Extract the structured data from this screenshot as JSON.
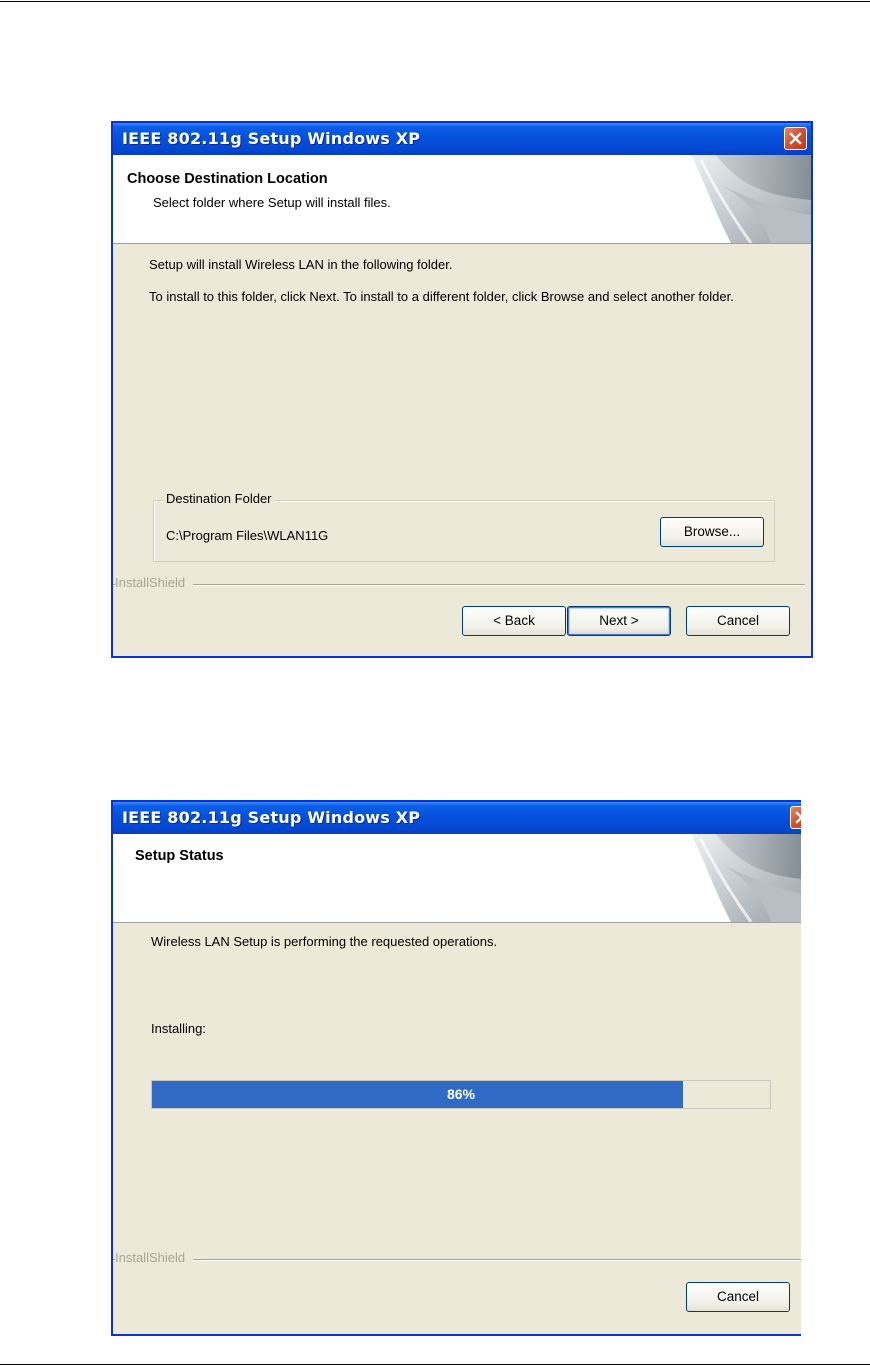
{
  "dialog1": {
    "title": "IEEE 802.11g Setup Windows XP",
    "header_title": "Choose Destination Location",
    "header_subtitle": "Select folder where Setup will install files.",
    "line1": "Setup will install Wireless LAN in the following folder.",
    "line2": "To install to this folder, click Next. To install to a different folder, click Browse and select another folder.",
    "group_label": "Destination Folder",
    "folder_path": "C:\\Program Files\\WLAN11G",
    "browse_label": "Browse...",
    "brand": "InstallShield",
    "back_label": "< Back",
    "next_label": "Next >",
    "cancel_label": "Cancel"
  },
  "dialog2": {
    "title": "IEEE 802.11g Setup Windows XP",
    "header_title": "Setup Status",
    "line1": "Wireless LAN Setup is performing the requested operations.",
    "status_label": "Installing:",
    "progress_percent": 86,
    "progress_text": "86%",
    "brand": "InstallShield",
    "cancel_label": "Cancel"
  },
  "colors": {
    "titlebar": "#0550dc",
    "dialog_bg": "#ece9d8",
    "progress_fill": "#316ac5",
    "close_button": "#d5512f"
  },
  "icons": [
    "close-icon",
    "installshield-header-art"
  ]
}
